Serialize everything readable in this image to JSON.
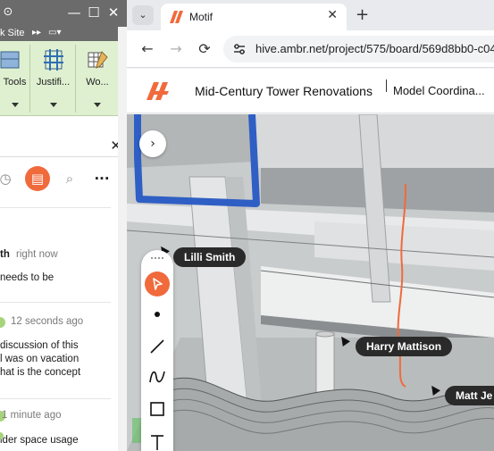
{
  "left_app": {
    "window_controls": {
      "minimize": "—",
      "maximize": "☐",
      "close": "✕"
    },
    "site_label": "k Site",
    "ribbon": [
      {
        "label": "Tools",
        "icon": "tools-icon"
      },
      {
        "label": "Justifi...",
        "icon": "justify-icon"
      },
      {
        "label": "Wo...",
        "icon": "workset-icon"
      }
    ],
    "panel_close": "✕",
    "comments": [
      {
        "author_fragment": "th",
        "time": "right now",
        "lines": [
          "needs to be"
        ]
      },
      {
        "time": "12 seconds ago",
        "lines": [
          "discussion of this",
          "l was on vacation",
          "hat is the concept"
        ]
      },
      {
        "time": "1 minute ago",
        "lines": [
          "ider space usage"
        ]
      }
    ]
  },
  "browser": {
    "tab": {
      "title": "Motif",
      "close": "✕"
    },
    "new_tab": "+",
    "tab_dropdown": "⌄",
    "url": "hive.ambr.net/project/575/board/569d8bb0-c04",
    "nav": {
      "back": "←",
      "forward": "→",
      "reload": "⟳"
    }
  },
  "app": {
    "project_title": "Mid-Century Tower Renovations",
    "model_title": "Model Coordina...",
    "expand_icon": "›",
    "brand_color": "#f06a3c"
  },
  "collaborators": [
    {
      "name": "Lilli Smith"
    },
    {
      "name": "Harry Mattison"
    },
    {
      "name": "Matt Je"
    }
  ],
  "draw_tools": [
    "select-icon",
    "dot-icon",
    "line-icon",
    "freehand-icon",
    "rectangle-icon",
    "text-icon"
  ]
}
